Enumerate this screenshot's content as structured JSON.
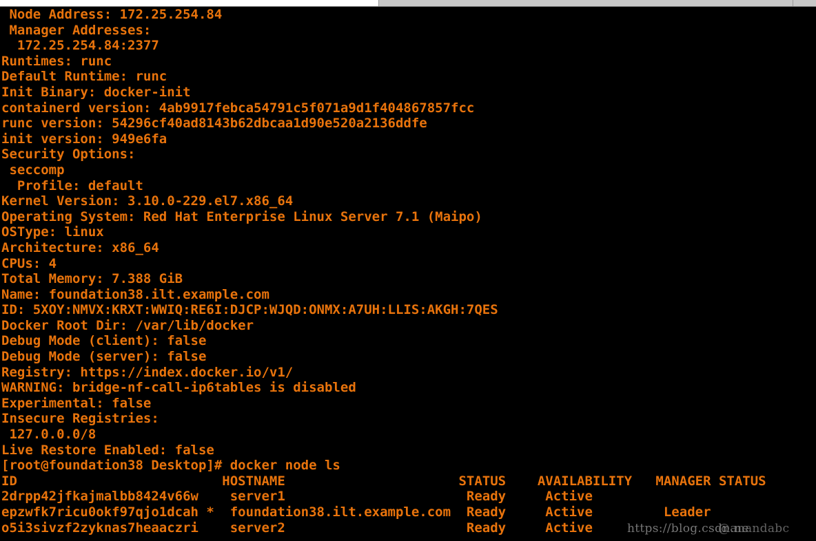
{
  "colors": {
    "background": "#000000",
    "text": "#e8730c",
    "chrome_bar": "#c8c8c8",
    "chrome_active_tab": "#ffffff",
    "watermark": "#8a8a8a"
  },
  "window_chrome": {
    "present": true,
    "description": "partial browser/window tab strip"
  },
  "terminal": {
    "prompt": "[root@foundation38 Desktop]# ",
    "command": "docker node ls",
    "info_lines": [
      " Node Address: 172.25.254.84",
      " Manager Addresses:",
      "  172.25.254.84:2377",
      "Runtimes: runc",
      "Default Runtime: runc",
      "Init Binary: docker-init",
      "containerd version: 4ab9917febca54791c5f071a9d1f404867857fcc",
      "runc version: 54296cf40ad8143b62dbcaa1d90e520a2136ddfe",
      "init version: 949e6fa",
      "Security Options:",
      " seccomp",
      "  Profile: default",
      "Kernel Version: 3.10.0-229.el7.x86_64",
      "Operating System: Red Hat Enterprise Linux Server 7.1 (Maipo)",
      "OSType: linux",
      "Architecture: x86_64",
      "CPUs: 4",
      "Total Memory: 7.388 GiB",
      "Name: foundation38.ilt.example.com",
      "ID: 5XOY:NMVX:KRXT:WWIQ:RE6I:DJCP:WJQD:ONMX:A7UH:LLIS:AKGH:7QES",
      "Docker Root Dir: /var/lib/docker",
      "Debug Mode (client): false",
      "Debug Mode (server): false",
      "Registry: https://index.docker.io/v1/",
      "WARNING: bridge-nf-call-ip6tables is disabled",
      "Experimental: false",
      "Insecure Registries:",
      " 127.0.0.0/8",
      "Live Restore Enabled: false"
    ],
    "command_line": "[root@foundation38 Desktop]# docker node ls",
    "node_table": {
      "header_line": "ID                          HOSTNAME                      STATUS    AVAILABILITY   MANAGER STATUS",
      "columns": [
        "ID",
        "HOSTNAME",
        "STATUS",
        "AVAILABILITY",
        "MANAGER STATUS"
      ],
      "rows": [
        {
          "line": "2drpp42jfkajmalbb8424v66w    server1                       Ready     Active",
          "id": "2drpp42jfkajmalbb8424v66w",
          "hostname": "server1",
          "status": "Ready",
          "availability": "Active",
          "manager_status": ""
        },
        {
          "line": "epzwfk7ricu0okf97qjo1dcah *  foundation38.ilt.example.com  Ready     Active         Leader",
          "id": "epzwfk7ricu0okf97qjo1dcah *",
          "hostname": "foundation38.ilt.example.com",
          "status": "Ready",
          "availability": "Active",
          "manager_status": "Leader"
        },
        {
          "line": "o5i3sivzf2zyknas7heaaczri    server2                       Ready     Active",
          "id": "o5i3sivzf2zyknas7heaaczri",
          "hostname": "server2",
          "status": "Ready",
          "availability": "Active",
          "manager_status": ""
        }
      ]
    }
  },
  "watermark": {
    "url": "https://blog.csdn.ne",
    "handle": "@anandabc"
  }
}
